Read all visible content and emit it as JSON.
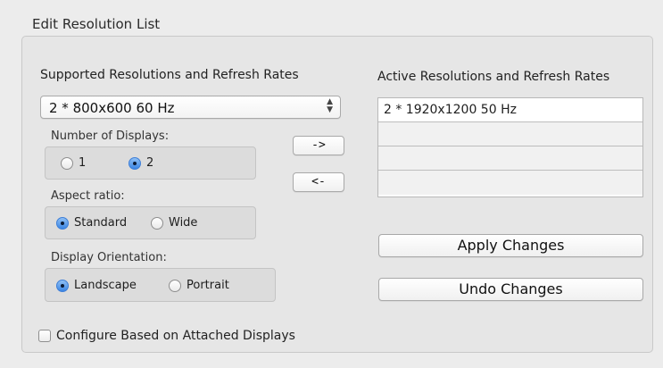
{
  "group": {
    "title": "Edit Resolution List"
  },
  "supported": {
    "heading": "Supported Resolutions and Refresh Rates",
    "selected": "2 * 800x600 60 Hz"
  },
  "displays": {
    "label": "Number of Displays:",
    "options": [
      "1",
      "2"
    ],
    "selected": "2"
  },
  "aspect": {
    "label": "Aspect ratio:",
    "options": [
      "Standard",
      "Wide"
    ],
    "selected": "Standard"
  },
  "orientation": {
    "label": "Display Orientation:",
    "options": [
      "Landscape",
      "Portrait"
    ],
    "selected": "Landscape"
  },
  "transfer": {
    "add_label": "->",
    "remove_label": "<-"
  },
  "active": {
    "heading": "Active Resolutions and Refresh Rates",
    "items": [
      "2 * 1920x1200 50 Hz",
      "",
      "",
      ""
    ]
  },
  "actions": {
    "apply_label": "Apply Changes",
    "undo_label": "Undo Changes"
  },
  "configure": {
    "label": "Configure Based on Attached Displays",
    "checked": false
  }
}
